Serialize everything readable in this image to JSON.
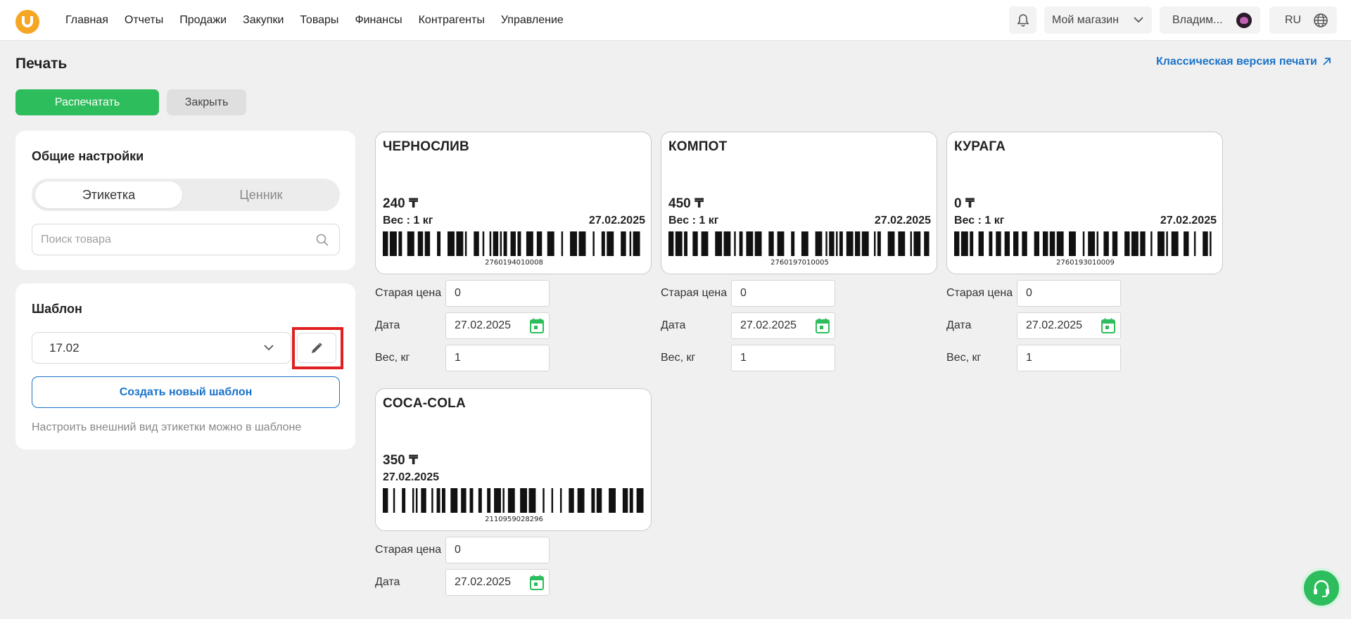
{
  "nav": {
    "menu": [
      "Главная",
      "Отчеты",
      "Продажи",
      "Закупки",
      "Товары",
      "Финансы",
      "Контрагенты",
      "Управление"
    ],
    "store": "Мой магазин",
    "user": "Владим...",
    "lang": "RU"
  },
  "page": {
    "title": "Печать",
    "classic_link": "Классическая версия печати",
    "print_button": "Распечатать",
    "close_button": "Закрыть"
  },
  "general": {
    "title": "Общие настройки",
    "tab_label": "Этикетка",
    "tab_price": "Ценник",
    "search_placeholder": "Поиск товара"
  },
  "template": {
    "title": "Шаблон",
    "selected": "17.02",
    "create_button": "Создать новый шаблон",
    "hint": "Настроить внешний вид этикетки можно в шаблоне"
  },
  "fields": {
    "old_price": "Старая цена",
    "date": "Дата",
    "weight": "Вес, кг"
  },
  "labels": [
    {
      "name": "ЧЕРНОСЛИВ",
      "price": "240 ₸",
      "weight": "Вес : 1 кг",
      "date": "27.02.2025",
      "barcode": "2760194010008",
      "old_price": "0",
      "date_value": "27.02.2025",
      "weight_value": "1"
    },
    {
      "name": "КОМПОТ",
      "price": "450 ₸",
      "weight": "Вес : 1 кг",
      "date": "27.02.2025",
      "barcode": "2760197010005",
      "old_price": "0",
      "date_value": "27.02.2025",
      "weight_value": "1"
    },
    {
      "name": "КУРАГА",
      "price": "0 ₸",
      "weight": "Вес : 1 кг",
      "date": "27.02.2025",
      "barcode": "2760193010009",
      "old_price": "0",
      "date_value": "27.02.2025",
      "weight_value": "1"
    },
    {
      "name": "COCA-COLA",
      "price": "350 ₸",
      "date": "27.02.2025",
      "barcode": "2110959028296",
      "old_price": "0",
      "date_value": "27.02.2025"
    }
  ],
  "colors": {
    "accent_green": "#2ebd5c",
    "link_blue": "#1a73c8",
    "highlight_red": "#e02020",
    "logo_orange": "#f5a623"
  }
}
